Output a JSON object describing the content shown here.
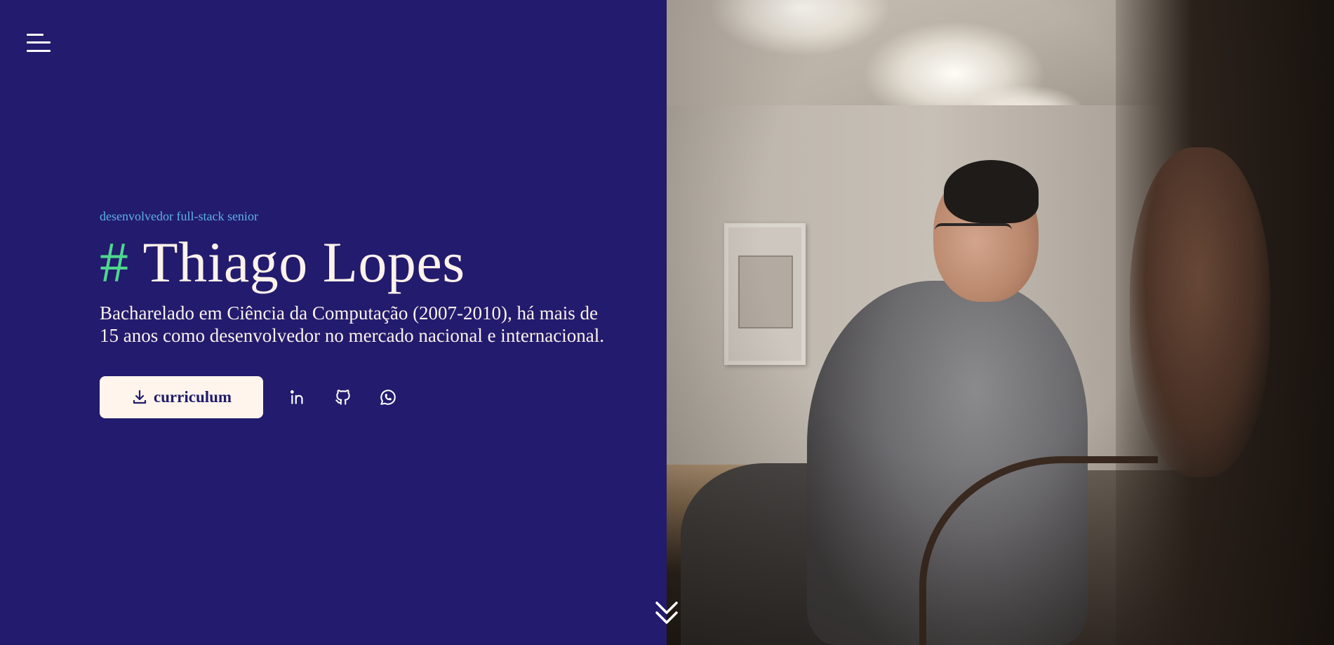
{
  "nav": {
    "menu_icon": "hamburger-menu-icon"
  },
  "hero": {
    "subtitle": "desenvolvedor full-stack senior",
    "hash": "#",
    "name": "Thiago Lopes",
    "description": "Bacharelado em Ciência da Computação (2007-2010), há mais de 15 anos como desenvolvedor no mercado nacional e internacional."
  },
  "actions": {
    "cv_button_label": "curriculum",
    "cv_button_icon": "download-icon",
    "social": [
      {
        "name": "linkedin-icon"
      },
      {
        "name": "github-icon"
      },
      {
        "name": "whatsapp-icon"
      }
    ]
  },
  "scroll": {
    "icon": "double-chevron-down-icon"
  },
  "colors": {
    "background": "#221b6e",
    "accent_green": "#4fd78d",
    "subtitle_blue": "#5fb2e5",
    "text_light": "#fbf2ea",
    "button_bg": "#fff5ec"
  }
}
